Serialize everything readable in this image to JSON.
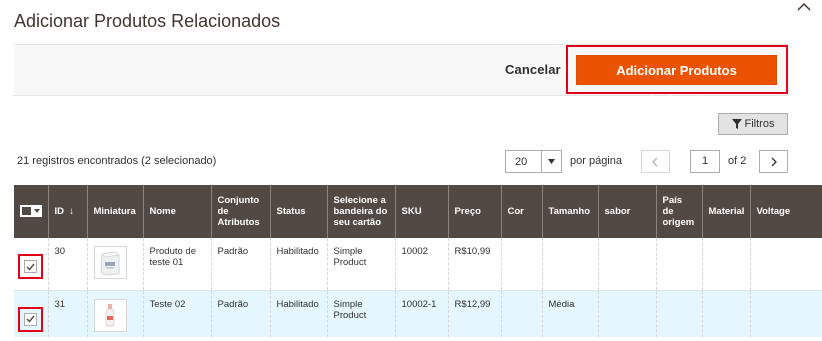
{
  "modal": {
    "title": "Adicionar Produtos Relacionados",
    "cancel_label": "Cancelar",
    "primary_label": "Adicionar Produtos Selecionados"
  },
  "toolbar": {
    "filters_label": "Filtros",
    "records_info": "21 registros encontrados (2 selecionado)",
    "per_page_value": "20",
    "per_page_label": "por página",
    "current_page": "1",
    "page_total": "of 2"
  },
  "grid": {
    "headers": {
      "id": "ID",
      "thumbnail": "Miniatura",
      "name": "Nome",
      "attribute_set": "Conjunto de Atributos",
      "status": "Status",
      "card_brand": "Selecione a bandeira do seu cartão",
      "sku": "SKU",
      "price": "Preço",
      "color": "Cor",
      "size": "Tamanho",
      "flavor": "sabor",
      "origin": "País de origem",
      "material": "Material",
      "voltage": "Voltage"
    },
    "sort_indicator": "↓",
    "rows": [
      {
        "checked": true,
        "id": "30",
        "name": "Produto de teste 01",
        "attribute_set": "Padrão",
        "status": "Habilitado",
        "card_brand": "Simple Product",
        "sku": "10002",
        "price": "R$10,99",
        "color": "",
        "size": "",
        "flavor": "",
        "origin": "",
        "material": "",
        "voltage": ""
      },
      {
        "checked": true,
        "id": "31",
        "name": "Teste 02",
        "attribute_set": "Padrão",
        "status": "Habilitado",
        "card_brand": "Simple Product",
        "sku": "10002-1",
        "price": "R$12,99",
        "color": "",
        "size": "Média",
        "flavor": "",
        "origin": "",
        "material": "",
        "voltage": ""
      }
    ]
  },
  "colors": {
    "primary": "#eb5202",
    "header_bg": "#514943",
    "highlight": "#e3001b",
    "selected_row": "#e5f7fe"
  }
}
